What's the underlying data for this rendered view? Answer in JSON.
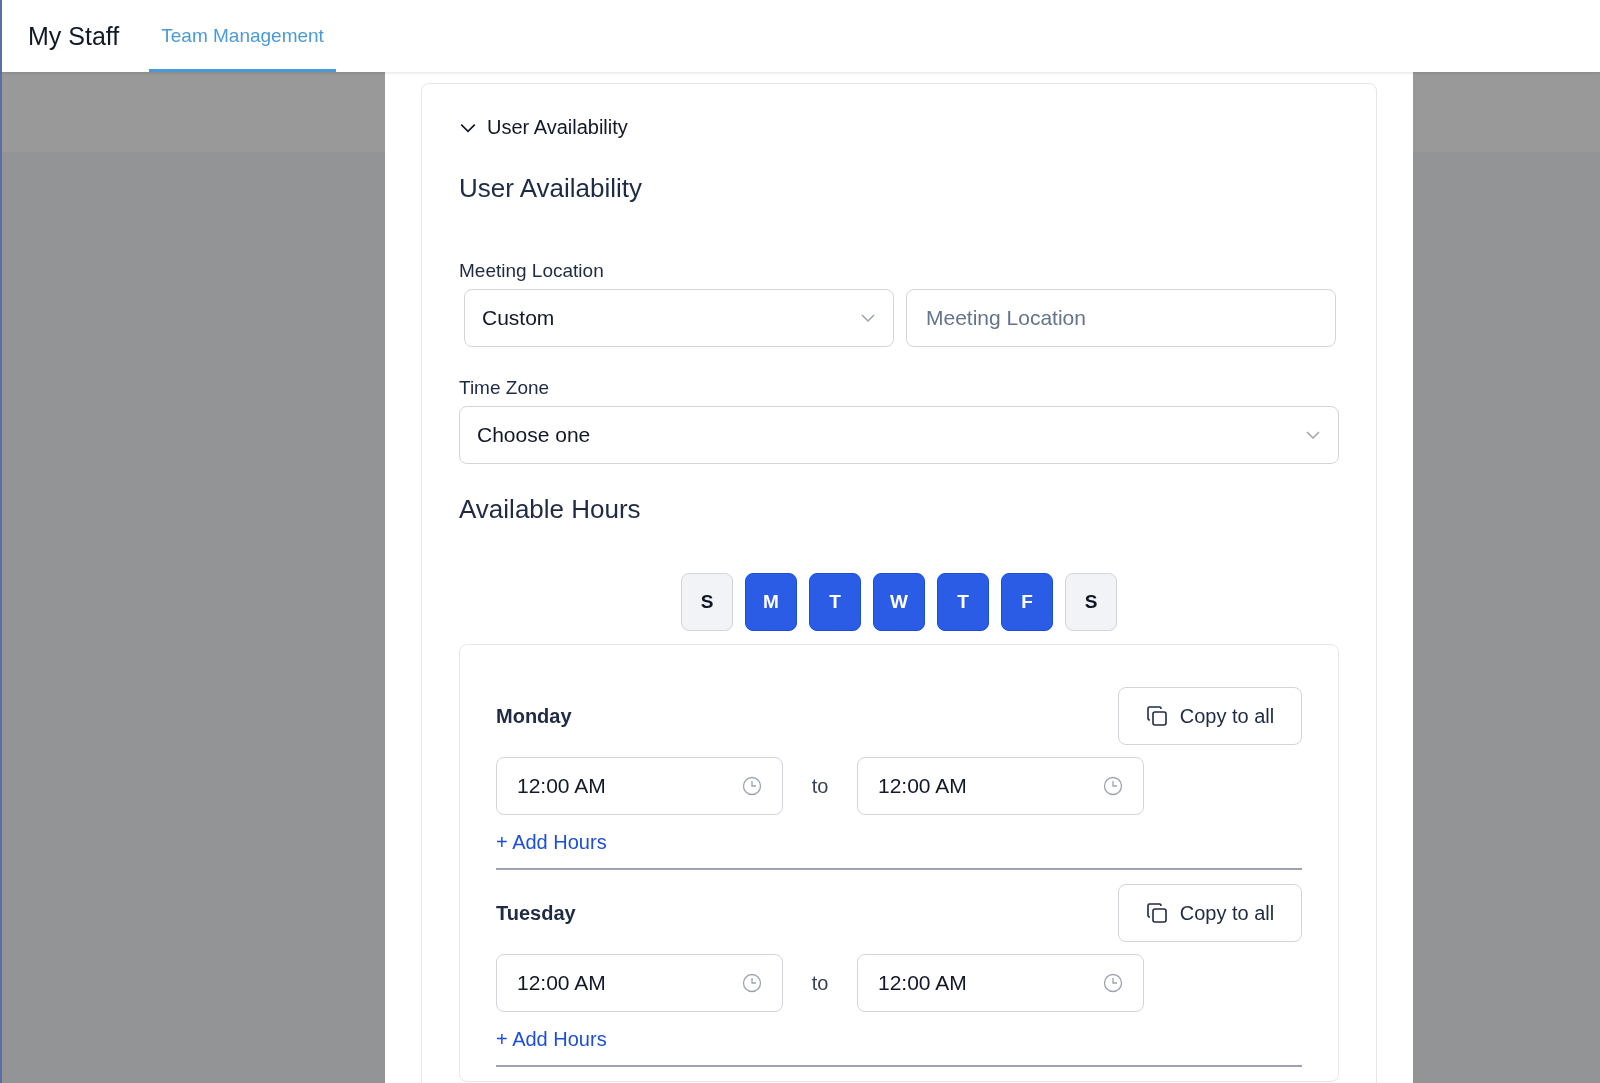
{
  "header": {
    "title": "My Staff",
    "tabs": [
      {
        "label": "Team Management",
        "selected": true
      }
    ]
  },
  "section": {
    "toggle_label": "User Availability",
    "expanded": true,
    "title": "User Availability",
    "meeting_location": {
      "label": "Meeting Location",
      "type_value": "Custom",
      "location_placeholder": "Meeting Location"
    },
    "time_zone": {
      "label": "Time Zone",
      "value": "Choose one"
    },
    "available_hours": {
      "title": "Available Hours",
      "days": [
        {
          "label": "S",
          "selected": false
        },
        {
          "label": "M",
          "selected": true
        },
        {
          "label": "T",
          "selected": true
        },
        {
          "label": "W",
          "selected": true
        },
        {
          "label": "T",
          "selected": true
        },
        {
          "label": "F",
          "selected": true
        },
        {
          "label": "S",
          "selected": false
        }
      ],
      "schedule": [
        {
          "day": "Monday",
          "copy_label": "Copy to all",
          "ranges": [
            {
              "from": "12:00 AM",
              "separator": "to",
              "to": "12:00 AM"
            }
          ],
          "add_label": "+ Add Hours"
        },
        {
          "day": "Tuesday",
          "copy_label": "Copy to all",
          "ranges": [
            {
              "from": "12:00 AM",
              "separator": "to",
              "to": "12:00 AM"
            }
          ],
          "add_label": "+ Add Hours"
        }
      ]
    }
  }
}
